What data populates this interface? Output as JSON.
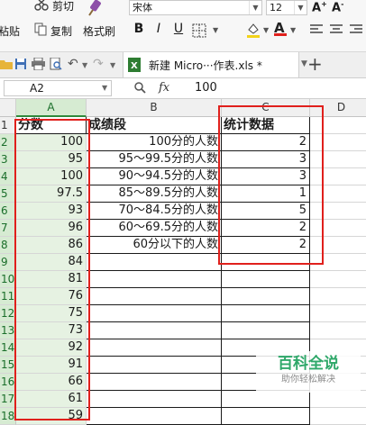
{
  "ribbon": {
    "cut_label": "剪切",
    "paste_label": "粘贴",
    "copy_label": "复制",
    "format_painter_label": "格式刷",
    "font_name": "宋体",
    "font_size": "12",
    "bold": "B",
    "italic": "I",
    "underline": "U",
    "font_color_letter": "A"
  },
  "tabbar": {
    "doc_tab_label": "新建 Micro···作表.xls *",
    "add_tab": "+"
  },
  "formula_bar": {
    "cell_ref": "A2",
    "fx": "fx",
    "value": "100"
  },
  "columns": [
    "A",
    "B",
    "C",
    "D"
  ],
  "rows": [
    "1",
    "2",
    "3",
    "4",
    "5",
    "6",
    "7",
    "8",
    "9",
    "10",
    "11",
    "12",
    "13",
    "14",
    "15",
    "16",
    "17",
    "18"
  ],
  "headers": {
    "a": "分数",
    "b": "成绩段",
    "c": "统计数据"
  },
  "col_a": [
    "100",
    "95",
    "100",
    "97.5",
    "93",
    "96",
    "86",
    "84",
    "81",
    "76",
    "75",
    "73",
    "92",
    "91",
    "66",
    "61",
    "59"
  ],
  "col_b": [
    "100分的人数",
    "95～99.5分的人数",
    "90～94.5分的人数",
    "85～89.5分的人数",
    "70～84.5分的人数",
    "60～69.5分的人数",
    "60分以下的人数"
  ],
  "col_c": [
    "2",
    "3",
    "3",
    "1",
    "5",
    "2",
    "2"
  ],
  "watermark": {
    "title": "百科全说",
    "subtitle": "助你轻松解决"
  },
  "colors": {
    "accent_green": "#2fa86a",
    "highlight_red": "#e0201c",
    "selected_col": "#d6ebd2"
  }
}
